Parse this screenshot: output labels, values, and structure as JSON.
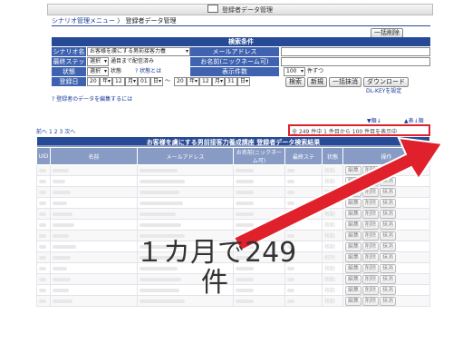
{
  "window": {
    "title": "登録者データ管理"
  },
  "breadcrumb": {
    "parent": "シナリオ管理メニュー",
    "separator": "〉",
    "current": "登録者データ管理"
  },
  "toolbar": {
    "bulk_delete": "一括削除"
  },
  "search": {
    "header": "検索条件",
    "scenario_label": "シナリオ名",
    "scenario_value": "お客様を虜にする男前接客力養",
    "email_label": "メールアドレス",
    "step_label": "最終ステップ",
    "step_value": "選択",
    "step_suffix": "通目まで配信済み",
    "nickname_label": "お名前(ニックネーム可)",
    "status_label": "状態",
    "status_value": "選択",
    "status_suffix": "状態",
    "status_help": "? 状態とは",
    "display_label": "表示件数",
    "display_value": "100",
    "display_suffix": "件ずつ",
    "date_label": "登録日",
    "date_from": {
      "year": "20",
      "year_sel": "年",
      "month": "12",
      "month_sel": "月",
      "day": "01",
      "day_sel": "日"
    },
    "date_sep": "〜",
    "date_to": {
      "year": "20",
      "year_sel": "年",
      "month": "12",
      "month_sel": "月",
      "day": "31",
      "day_sel": "日"
    },
    "btn_search": "検索",
    "btn_new": "新規",
    "btn_bulk_delete": "一括抹消",
    "btn_download": "ダウンロード",
    "dlkey": "DL-KEYを設定",
    "edit_help": "? 登録者のデータを編集するには"
  },
  "pager": {
    "prev": "前へ",
    "pages": [
      "1",
      "2",
      "3"
    ],
    "next": "次へ",
    "summary": "全 249 件中 1 件目から 100 件目を表示中",
    "sort_asc": "▼順↓",
    "sort_desc": "▲表↓順"
  },
  "table": {
    "title": "お客様を虜にする男前接客力養成講座 登録者データ検索結果",
    "columns": [
      "UID",
      "名前",
      "メールアドレス",
      "お名前(ニックネーム可)",
      "最終ステ",
      "状態",
      "操作"
    ],
    "rows": [
      {
        "status": "稼動"
      },
      {
        "status": "稼動"
      },
      {
        "status": "稼動"
      },
      {
        "status": "稼動"
      },
      {
        "status": "稼動"
      },
      {
        "status": "稼動"
      },
      {
        "status": "稼動"
      },
      {
        "status": "稼動"
      },
      {
        "status": "解除"
      },
      {
        "status": "稼動"
      },
      {
        "status": "稼動"
      },
      {
        "status": "稼動"
      },
      {
        "status": "稼動"
      }
    ],
    "op_edit": "編集",
    "op_delete": "削除",
    "op_erase": "抹消"
  },
  "annotation": {
    "line1": "１カ月で249",
    "line2": "件"
  },
  "colors": {
    "header_blue": "#274a96",
    "label_blue": "#3f63b0",
    "highlight_red": "#e0202a"
  }
}
